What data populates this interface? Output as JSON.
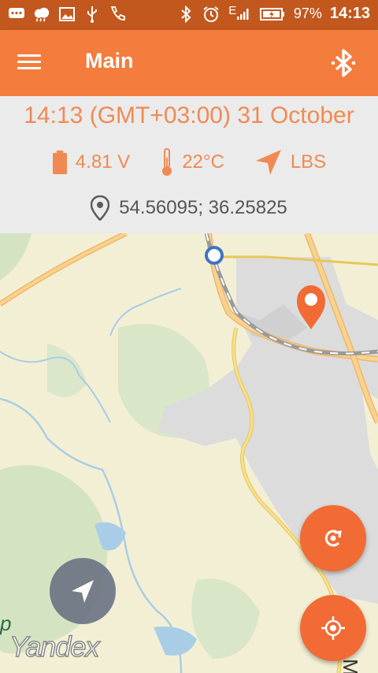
{
  "status_bar": {
    "battery_percent": "97%",
    "time": "14:13",
    "network": "E"
  },
  "app_bar": {
    "title": "Main"
  },
  "info": {
    "datetime": "14:13 (GMT+03:00) 31 October",
    "voltage": "4.81 V",
    "temperature": "22°C",
    "location_source": "LBS",
    "coordinates": "54.56095;  36.25825"
  },
  "map": {
    "provider": "Yandex",
    "edge_label": "Mos",
    "edge_letter": "p"
  },
  "colors": {
    "accent": "#F47C3C",
    "status_bar": "#C2581E",
    "info_text": "#F08A52",
    "fab": "#F26A34"
  }
}
